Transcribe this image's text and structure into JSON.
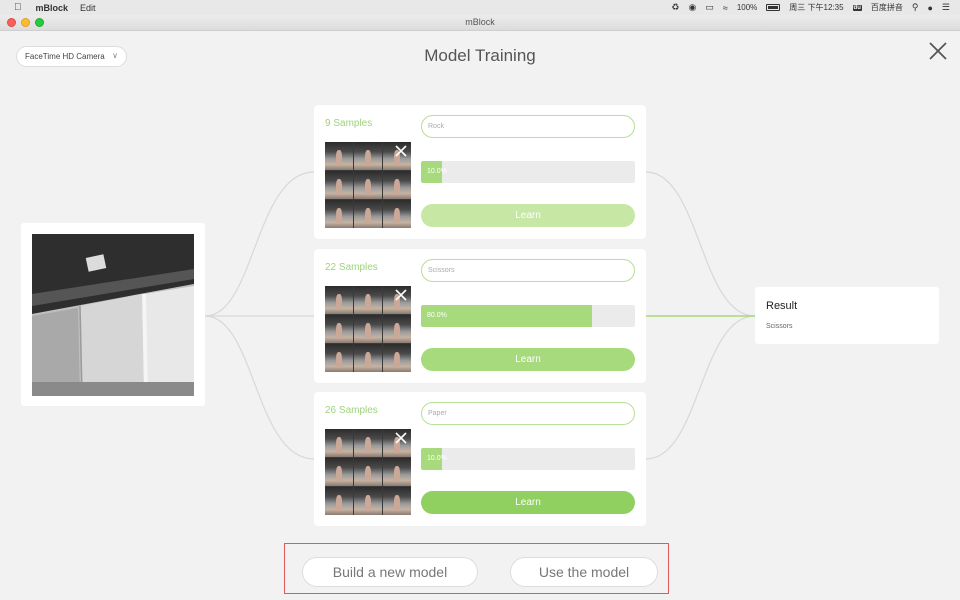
{
  "menubar": {
    "app_name": "mBlock",
    "edit": "Edit",
    "battery": "100%",
    "clock": "周三 下午12:35",
    "ime_badge": "du",
    "ime_label": "百度拼音"
  },
  "window": {
    "title": "mBlock"
  },
  "camera": {
    "selected": "FaceTime HD Camera"
  },
  "page": {
    "title": "Model Training"
  },
  "classes": [
    {
      "samples": "9 Samples",
      "label": "Rock",
      "progress_text": "10.0%",
      "progress": 0.1,
      "learn_label": "Learn",
      "learn_color": "#c6e8a4"
    },
    {
      "samples": "22 Samples",
      "label": "Scissors",
      "progress_text": "80.0%",
      "progress": 0.8,
      "learn_label": "Learn",
      "learn_color": "#a6da7c"
    },
    {
      "samples": "26 Samples",
      "label": "Paper",
      "progress_text": "10.0%",
      "progress": 0.1,
      "learn_label": "Learn",
      "learn_color": "#8fd060"
    }
  ],
  "result": {
    "title": "Result",
    "value": "Scissors"
  },
  "actions": {
    "build_label": "Build a new model",
    "use_label": "Use the model"
  },
  "colors": {
    "accent_green": "#a6da7c",
    "highlight_box": "#e05a5a"
  }
}
